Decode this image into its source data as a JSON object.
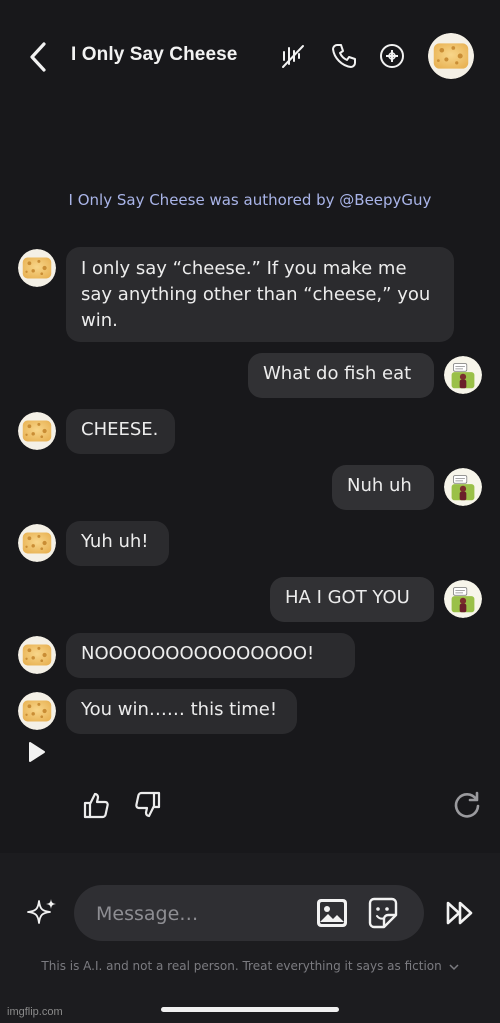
{
  "header": {
    "title": "I Only Say Cheese",
    "icons": [
      "back-chevron-icon",
      "mute-voice-icon",
      "phone-icon",
      "info-icon",
      "character-avatar"
    ]
  },
  "author_note": "I Only Say Cheese was authored by @BeepyGuy",
  "messages": [
    {
      "sender": "bot",
      "text": "I only say “cheese.” If you make me say anything other than “cheese,” you win."
    },
    {
      "sender": "user",
      "text": "What do fish eat"
    },
    {
      "sender": "bot",
      "text": "CHEESE."
    },
    {
      "sender": "user",
      "text": "Nuh uh"
    },
    {
      "sender": "bot",
      "text": "Yuh uh!"
    },
    {
      "sender": "user",
      "text": "HA I GOT YOU"
    },
    {
      "sender": "bot",
      "text": "NOOOOOOOOOOOOOOO!"
    },
    {
      "sender": "bot",
      "text": "You win…… this time!"
    }
  ],
  "actions": [
    "play-icon",
    "thumbs-up-icon",
    "thumbs-down-icon",
    "regenerate-icon"
  ],
  "composer": {
    "placeholder": "Message…",
    "icons": [
      "sparkle-icon",
      "image-icon",
      "sticker-icon",
      "fast-forward-icon"
    ]
  },
  "disclaimer": "This is A.I. and not a real person. Treat everything it says as fiction",
  "watermark": "imgflip.com",
  "colors": {
    "background": "#18181b",
    "bot_bubble": "#2b2b2e",
    "user_bubble": "#313134",
    "author_note": "#a9b4e8",
    "cheese": "#f2c46b"
  }
}
